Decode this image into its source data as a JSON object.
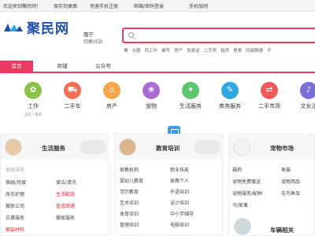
{
  "topbar": {
    "welcome": "欢迎来到聚民网！",
    "save_desktop": "保存到桌面",
    "mobile_reg": "快速手机注册",
    "email_login": "邮箱/密码登录",
    "mobile_version": "手机版网"
  },
  "header": {
    "logo_text": "聚民网",
    "city": "南宁",
    "switch_city": "切换分站",
    "search_placeholder": "",
    "hot_keywords": [
      "兼",
      "水圈",
      "找工作",
      "编号",
      "房产",
      "免费送",
      "二手房",
      "租房",
      "更美",
      "同城数据",
      "开"
    ]
  },
  "nav": {
    "tabs": [
      {
        "label": "首页",
        "active": true
      },
      {
        "label": "商铺",
        "active": false
      },
      {
        "label": "公众号",
        "active": false
      }
    ]
  },
  "categories": [
    {
      "label": "工作",
      "sub": "全职 / 兼职",
      "icon": "briefcase-icon",
      "color": "#8bc34a",
      "glyph": "✿"
    },
    {
      "label": "二手车",
      "sub": "",
      "icon": "car-icon",
      "color": "#f26f55",
      "glyph": "⛟"
    },
    {
      "label": "房产",
      "sub": "",
      "icon": "house-icon",
      "color": "#f4a64a",
      "glyph": "⌂"
    },
    {
      "label": "宠物",
      "sub": "",
      "icon": "pet-icon",
      "color": "#a86bd1",
      "glyph": "❀"
    },
    {
      "label": "生活服务",
      "sub": "",
      "icon": "service-icon",
      "color": "#5cc56d",
      "glyph": "✦"
    },
    {
      "label": "商务服务",
      "sub": "",
      "icon": "business-icon",
      "color": "#2fa8e0",
      "glyph": "✎"
    },
    {
      "label": "二手市场",
      "sub": "",
      "icon": "market-icon",
      "color": "#ef5a5a",
      "glyph": "⇄"
    },
    {
      "label": "文女活",
      "sub": "",
      "icon": "culture-icon",
      "color": "#7a6fd6",
      "glyph": "♪"
    }
  ],
  "panels": {
    "life": {
      "title": "生活服务",
      "heading": "家政服务",
      "items": [
        {
          "text": "保姆/月嫂",
          "cls": ""
        },
        {
          "text": "保洁/清洗",
          "cls": ""
        },
        {
          "text": "改衣护理",
          "cls": ""
        },
        {
          "text": "生活配送",
          "cls": "red"
        },
        {
          "text": "搬家公司",
          "cls": ""
        },
        {
          "text": "管道疏通",
          "cls": "red"
        },
        {
          "text": "白事服务",
          "cls": ""
        },
        {
          "text": "搬家服务",
          "cls": ""
        },
        {
          "text": "家装材料",
          "cls": "red"
        }
      ]
    },
    "edu": {
      "title": "教育培训",
      "items": [
        "家教机构",
        "职业技能",
        "婴幼儿教育",
        "家教个人",
        "学历教育",
        "外语培训",
        "艺术培训",
        "设计培训",
        "体育培训",
        "中小学辅导",
        "管理培训",
        "电脑培训"
      ]
    },
    "pet": {
      "title": "宠物市场",
      "items": [
        "猫狗",
        "鱼猫",
        "宠物免费赠送",
        "宠物用品",
        "宠物服务/配种",
        "花鸟鱼虫",
        "马/家禽",
        ""
      ],
      "sub_title": "车辆相关"
    }
  }
}
